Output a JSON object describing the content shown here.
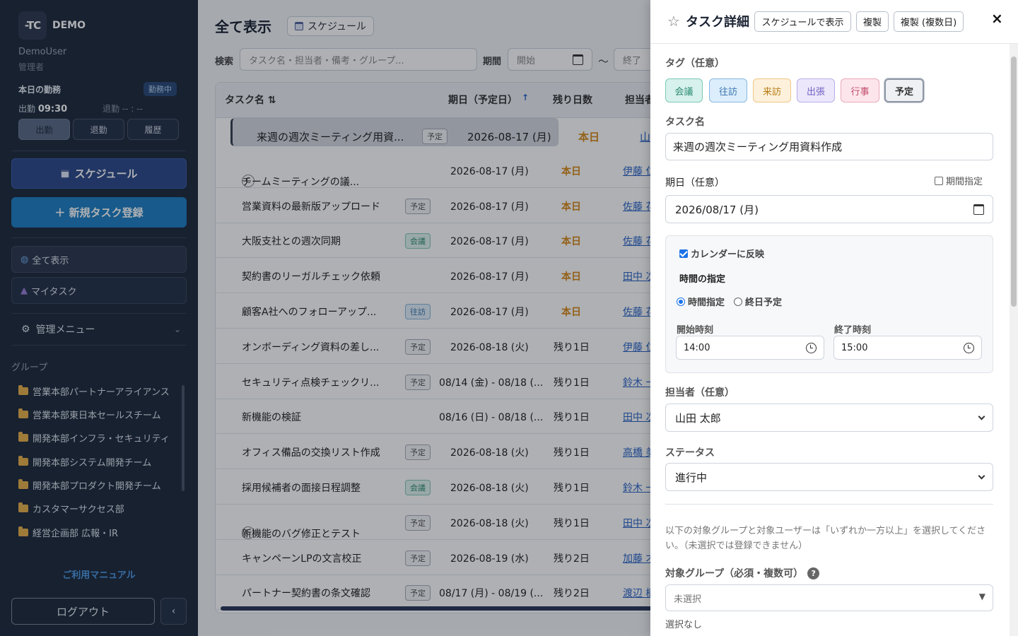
{
  "sidebar": {
    "logo": "-TC",
    "brand": "DEMO",
    "user": "DemoUser",
    "role": "管理者",
    "attendance": {
      "title": "本日の勤務",
      "status": "勤務中",
      "in_label": "出勤",
      "in_time": "09:30",
      "out_label": "退勤",
      "out_time": "-- : --"
    },
    "att_buttons": [
      "出勤",
      "退勤",
      "履歴"
    ],
    "schedule": "スケジュール",
    "new_task": "＋ 新規タスク登録",
    "nav": [
      "全て表示",
      "マイタスク"
    ],
    "admin": "管理メニュー",
    "groups_title": "グループ",
    "groups": [
      "営業本部パートナーアライアンス",
      "営業本部東日本セールスチーム",
      "開発本部インフラ・セキュリティ",
      "開発本部システム開発チーム",
      "開発本部プロダクト開発チーム",
      "カスタマーサクセス部",
      "経営企画部 広報・IR"
    ],
    "manual": "ご利用マニュアル",
    "logout": "ログアウト",
    "collapse": "‹"
  },
  "main": {
    "title": "全て表示",
    "schedule_btn": "スケジュール",
    "search_label": "検索",
    "search_placeholder": "タスク名・担当者・備考・グループ...",
    "period_label": "期間",
    "start": "開始",
    "tilde": "～",
    "end": "終了",
    "columns": {
      "name": "タスク名 ⇅",
      "due": "期日（予定日）",
      "due_sort": "↑",
      "remain": "残り日数",
      "owner": "担当者"
    },
    "rows": [
      {
        "name": "来週の週次ミーティング用資...",
        "tag": "予定",
        "tagtype": "",
        "due": "2026-08-17 (月)",
        "remain": "本日",
        "owner": "山田 太",
        "c": "",
        "sel": true
      },
      {
        "name": "チームミーティングの議...",
        "tag": "",
        "tagtype": "",
        "due": "2026-08-17 (月)",
        "remain": "本日",
        "owner": "伊藤 仁",
        "c": "C"
      },
      {
        "name": "営業資料の最新版アップロード",
        "tag": "予定",
        "tagtype": "",
        "due": "2026-08-17 (月)",
        "remain": "本日",
        "owner": "佐藤 花",
        "c": ""
      },
      {
        "name": "大阪支社との週次同期",
        "tag": "会議",
        "tagtype": "meet",
        "due": "2026-08-17 (月)",
        "remain": "本日",
        "owner": "佐藤 花",
        "c": ""
      },
      {
        "name": "契約書のリーガルチェック依頼",
        "tag": "",
        "tagtype": "",
        "due": "2026-08-17 (月)",
        "remain": "本日",
        "owner": "田中 次",
        "c": ""
      },
      {
        "name": "顧客A社へのフォローアップ...",
        "tag": "往訪",
        "tagtype": "visit",
        "due": "2026-08-17 (月)",
        "remain": "本日",
        "owner": "佐藤 花",
        "c": ""
      },
      {
        "name": "オンボーディング資料の差し...",
        "tag": "予定",
        "tagtype": "",
        "due": "2026-08-18 (火)",
        "remain": "残り1日",
        "owner": "伊藤 仁",
        "c": ""
      },
      {
        "name": "セキュリティ点検チェックリ...",
        "tag": "予定",
        "tagtype": "",
        "due": "08/14 (金) - 08/18 (...",
        "remain": "残り1日",
        "owner": "鈴木 一",
        "c": ""
      },
      {
        "name": "新機能の検証",
        "tag": "",
        "tagtype": "",
        "due": "08/16 (日) - 08/18 (...",
        "remain": "残り1日",
        "owner": "田中 次",
        "c": ""
      },
      {
        "name": "オフィス備品の交換リスト作成",
        "tag": "予定",
        "tagtype": "",
        "due": "2026-08-18 (火)",
        "remain": "残り1日",
        "owner": "高橋 美",
        "c": ""
      },
      {
        "name": "採用候補者の面接日程調整",
        "tag": "会議",
        "tagtype": "meet",
        "due": "2026-08-18 (火)",
        "remain": "残り1日",
        "owner": "鈴木 一",
        "c": ""
      },
      {
        "name": "新機能のバグ修正とテスト",
        "tag": "予定",
        "tagtype": "",
        "due": "2026-08-18 (火)",
        "remain": "残り1日",
        "owner": "田中 次",
        "c": "C"
      },
      {
        "name": "キャンペーンLPの文言校正",
        "tag": "予定",
        "tagtype": "",
        "due": "2026-08-19 (水)",
        "remain": "残り2日",
        "owner": "加藤 才",
        "c": ""
      },
      {
        "name": "パートナー契約書の条文確認",
        "tag": "予定",
        "tagtype": "",
        "due": "08/17 (月) - 08/19 (...",
        "remain": "残り2日",
        "owner": "渡辺 樹",
        "c": ""
      }
    ]
  },
  "panel": {
    "title": "タスク詳細",
    "btn_sched": "スケジュールで表示",
    "btn_copy": "複製",
    "btn_copy_multi": "複製 (複数日)",
    "close": "×",
    "tag_label": "タグ（任意）",
    "tags": [
      {
        "label": "会議",
        "bg": "#d7f1ec",
        "border": "#7cc9b6",
        "color": "#2a8a70"
      },
      {
        "label": "往訪",
        "bg": "#dcedfb",
        "border": "#86b8e3",
        "color": "#3b77b0"
      },
      {
        "label": "来訪",
        "bg": "#fdf1dc",
        "border": "#ecc783",
        "color": "#b97b12"
      },
      {
        "label": "出張",
        "bg": "#ece7fb",
        "border": "#b9aee8",
        "color": "#7561c3"
      },
      {
        "label": "行事",
        "bg": "#fce6ec",
        "border": "#eba7b8",
        "color": "#c44e6e"
      },
      {
        "label": "予定",
        "bg": "#eef0f3",
        "border": "#8e97a4",
        "color": "#333"
      }
    ],
    "name_label": "タスク名",
    "name_value": "来週の週次ミーティング用資料作成",
    "due_label": "期日（任意）",
    "period_check": "期間指定",
    "due_value": "2026/08/17 (月)",
    "calendar_reflect": "カレンダーに反映",
    "time_title": "時間の指定",
    "radio_time": "時間指定",
    "radio_allday": "終日予定",
    "start_label": "開始時刻",
    "start_value": "14:00",
    "end_label": "終了時刻",
    "end_value": "15:00",
    "owner_label": "担当者（任意）",
    "owner_value": "山田 太郎",
    "status_label": "ステータス",
    "status_value": "進行中",
    "note": "以下の対象グループと対象ユーザーは「いずれか一方以上」を選択してください。（未選択では登録できません）",
    "target_label": "対象グループ（必須・複数可）",
    "help": "?",
    "target_value": "未選択",
    "target_none": "選択なし"
  }
}
